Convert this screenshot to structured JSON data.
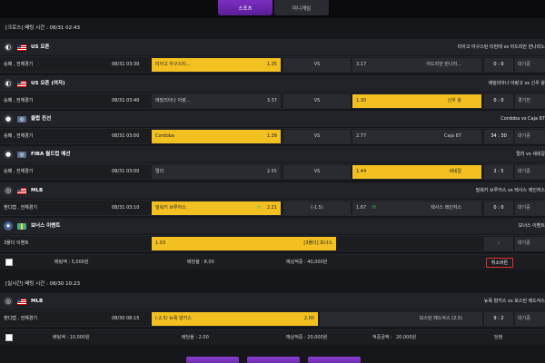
{
  "tabs": {
    "sports": "스포츠",
    "mini": "미니게임"
  },
  "sections": [
    {
      "title": "[크로스] 배팅 시간 : 08/31 02:43"
    },
    {
      "title": "[실시간] 배팅 시간 : 08/30 10:23"
    }
  ],
  "leagues": [
    {
      "name": "US 오픈",
      "match": "티아고 아구스틴 티란테 vs 아드리안 만나리노",
      "sport_icon": "tennis-icon"
    },
    {
      "name": "US 오픈 (여자)",
      "match": "에밀리아나 아랑고 vs 신우 왕",
      "sport_icon": "tennis-icon"
    },
    {
      "name": "클럽 친선",
      "match": "Cordoba vs Caja 87",
      "sport_icon": "basketball-icon"
    },
    {
      "name": "FIBA 월드컵 예선",
      "match": "멀리 vs 세네갈",
      "sport_icon": "basketball-icon"
    },
    {
      "name": "MLB",
      "match": "밀워키 브루어스 vs 텍사스 레인저스",
      "sport_icon": "baseball-icon"
    },
    {
      "name": "보너스 이벤트",
      "match": "보너스 이벤트",
      "sport_icon": "bonus-icon"
    },
    {
      "name": "MLB",
      "match": "뉴욕 양키스 vs 보스턴 레드삭스",
      "sport_icon": "baseball-icon"
    }
  ],
  "rows": [
    {
      "type": "승패 , 전체경기",
      "time": "08/31 03:30",
      "home": "티아고 아구스티...",
      "home_odd": "1.35",
      "mid": "VS",
      "away": "아드리안 만나리...",
      "away_odd": "3.17",
      "score": "0 : 0",
      "status": "대기중"
    },
    {
      "type": "승패 , 전체경기",
      "time": "08/31 03:40",
      "home": "에밀리아나 아랑...",
      "home_odd": "3.37",
      "mid": "VS",
      "away": "신우 왕",
      "away_odd": "1.30",
      "score": "0 : 0",
      "status": "경기진"
    },
    {
      "type": "승패 , 전체경기",
      "time": "08/31 03:00",
      "home": "Cordoba",
      "home_odd": "1.39",
      "mid": "VS",
      "away": "Caja 87",
      "away_odd": "2.77",
      "score": "34 : 30",
      "status": "대기중"
    },
    {
      "type": "승패 , 전체경기",
      "time": "08/31 03:00",
      "home": "멀리",
      "home_odd": "2.55",
      "mid": "VS",
      "away": "세네갈",
      "away_odd": "1.44",
      "score": "2 : 5",
      "status": "대기중"
    },
    {
      "type": "핸디캡 , 전체경기",
      "time": "08/31 03:10",
      "home": "밀워키 브루어스",
      "home_odd": "2.21",
      "home_up": "H",
      "mid": "(-1.5)",
      "away": "텍사스 레인저스",
      "away_odd": "1.67",
      "away_up": "H",
      "score": "0 : 0",
      "status": "대기중"
    }
  ],
  "bonus_row": {
    "type": "3폴더 이벤트",
    "label": "1.03",
    "right": "[3폴더] 보너스",
    "score": ":",
    "status": "대기중"
  },
  "summary1": {
    "bet": "배팅액 : 5,000원",
    "odds": "배당율 : 8.00",
    "expected": "예상적중 : 40,000원",
    "cancel": "취소버튼"
  },
  "live_row": {
    "type": "핸디캡 , 전체경기",
    "time": "08/30 08:15",
    "home": "(-2.5) 뉴욕 양키스",
    "home_odd": "2.00",
    "away": "보스턴 레드삭스 (2.5)",
    "away_odd": "",
    "score": "9 : 2",
    "status": "대기중"
  },
  "summary2": {
    "bet": "배팅액 : 10,000원",
    "odds": "배당율 : 2.00",
    "expected": "예상적중 : 20,000원",
    "win_label": "적중금액 :",
    "win_amount": "20,000원",
    "result": "당첨"
  },
  "colors": {
    "accent": "#f3c021",
    "brand": "#6b27b0",
    "cancel": "#e03030",
    "up": "#2ecc40"
  }
}
